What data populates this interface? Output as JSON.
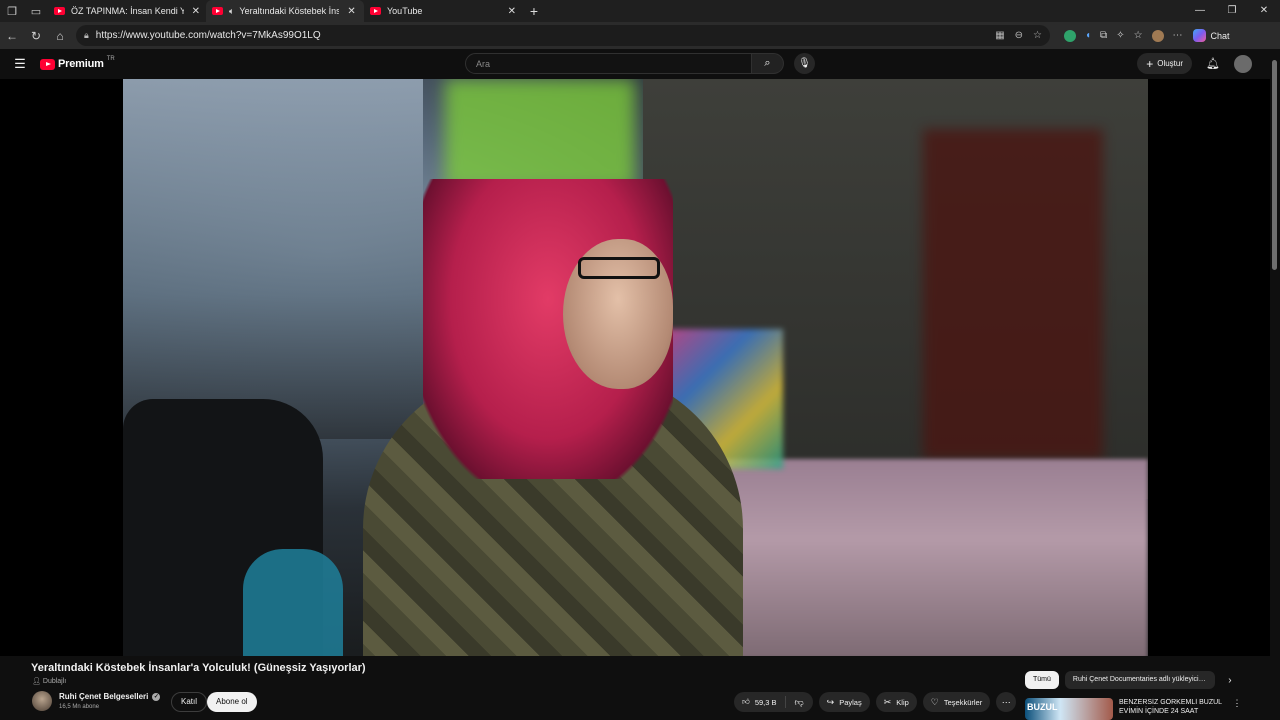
{
  "browser": {
    "tabs": [
      {
        "title": "ÖZ TAPINMA: İnsan Kendi Yüzünden Nasıl",
        "active": false,
        "audio": false
      },
      {
        "title": "Yeraltındaki Köstebek İnsanlar'a Yolculuk!",
        "active": true,
        "audio": true
      },
      {
        "title": "YouTube",
        "active": false,
        "audio": false
      }
    ],
    "new_tab_icon": "plus-icon",
    "url": "https://www.youtube.com/watch?v=7MkAs99O1LQ",
    "chat_label": "Chat"
  },
  "masthead": {
    "brand": "Premium",
    "region": "TR",
    "search_placeholder": "Ara",
    "create_label": "Oluştur"
  },
  "video": {
    "title": "Yeraltındaki Köstebek İnsanlar'a Yolculuk! (Güneşsiz Yaşıyorlar)",
    "dubbed_label": "Dublajlı",
    "channel_name": "Ruhi Çenet Belgeselleri",
    "subscribers": "16,5 Mn abone",
    "join_label": "Katıl",
    "subscribe_label": "Abone ol",
    "likes": "59,3 B",
    "share_label": "Paylaş",
    "clip_label": "Klip",
    "thanks_label": "Teşekkürler"
  },
  "sidebar": {
    "chips": [
      {
        "label": "Tümü",
        "selected": true
      },
      {
        "label": "Ruhi Çenet Documentaries adlı yükleyiciden",
        "selected": false
      }
    ],
    "recommendation": {
      "thumb_text": "BUZUL",
      "title": "BENZERSİZ GÖRKEMLİ BUZUL EVİMİN İÇİNDE 24 SAAT"
    }
  },
  "colors": {
    "background": "#0f0f0f",
    "brand_red": "#ff0033",
    "chip_selected": "#f1f1f1"
  }
}
